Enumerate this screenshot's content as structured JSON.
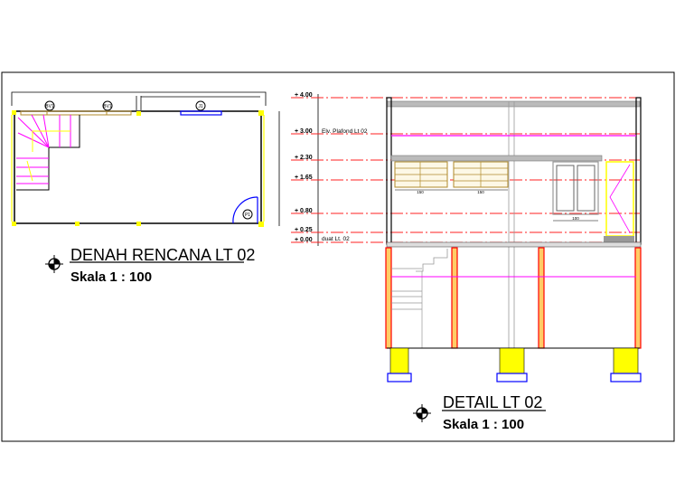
{
  "plan": {
    "title": "DENAH RENCANA LT 02",
    "scale": "Skala 1 : 100",
    "tags": [
      "BV1",
      "BV1",
      "J1",
      "P1"
    ]
  },
  "detail": {
    "title": "DETAIL LT 02",
    "scale": "Skala 1 : 100",
    "levels": [
      "+ 4.00",
      "+ 3.00",
      "+ 2.30",
      "+ 1.65",
      "+ 0.80",
      "+ 0.25",
      "+ 0.00"
    ],
    "level_notes": {
      "ceiling": "Elv. Plafond Lt 02",
      "floor": "duat Lt. 02"
    },
    "dims": [
      "150",
      "150",
      "100"
    ]
  },
  "colors": {
    "level_line": "#ff2020",
    "ceiling": "#ff00ff",
    "column": "#ff0000",
    "footing": "#ffff00",
    "window": "#0000ff",
    "frame": "#b08a2a"
  }
}
